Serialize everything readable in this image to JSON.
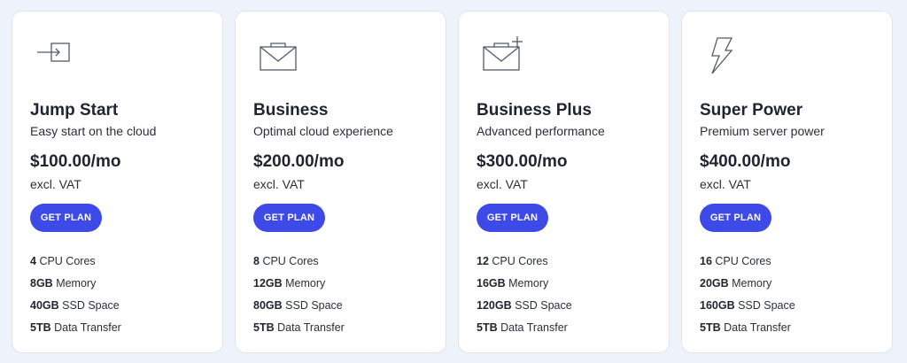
{
  "plans": [
    {
      "icon": "enter-icon",
      "name": "Jump Start",
      "subtitle": "Easy start on the cloud",
      "price": "$100.00/mo",
      "vat": "excl. VAT",
      "button": "GET PLAN",
      "features": [
        {
          "value": "4",
          "label": "CPU Cores"
        },
        {
          "value": "8GB",
          "label": "Memory"
        },
        {
          "value": "40GB",
          "label": "SSD Space"
        },
        {
          "value": "5TB",
          "label": "Data Transfer"
        }
      ]
    },
    {
      "icon": "envelope-icon",
      "name": "Business",
      "subtitle": "Optimal cloud experience",
      "price": "$200.00/mo",
      "vat": "excl. VAT",
      "button": "GET PLAN",
      "features": [
        {
          "value": "8",
          "label": "CPU Cores"
        },
        {
          "value": "12GB",
          "label": "Memory"
        },
        {
          "value": "80GB",
          "label": "SSD Space"
        },
        {
          "value": "5TB",
          "label": "Data Transfer"
        }
      ]
    },
    {
      "icon": "envelope-plus-icon",
      "name": "Business Plus",
      "subtitle": "Advanced performance",
      "price": "$300.00/mo",
      "vat": "excl. VAT",
      "button": "GET PLAN",
      "features": [
        {
          "value": "12",
          "label": "CPU Cores"
        },
        {
          "value": "16GB",
          "label": "Memory"
        },
        {
          "value": "120GB",
          "label": "SSD Space"
        },
        {
          "value": "5TB",
          "label": "Data Transfer"
        }
      ]
    },
    {
      "icon": "lightning-icon",
      "name": "Super Power",
      "subtitle": "Premium server power",
      "price": "$400.00/mo",
      "vat": "excl. VAT",
      "button": "GET PLAN",
      "features": [
        {
          "value": "16",
          "label": "CPU Cores"
        },
        {
          "value": "20GB",
          "label": "Memory"
        },
        {
          "value": "160GB",
          "label": "SSD Space"
        },
        {
          "value": "5TB",
          "label": "Data Transfer"
        }
      ]
    }
  ],
  "colors": {
    "accent": "#3d4ae8",
    "background": "#eef3fb",
    "card": "#ffffff",
    "icon_stroke": "#555b66"
  }
}
